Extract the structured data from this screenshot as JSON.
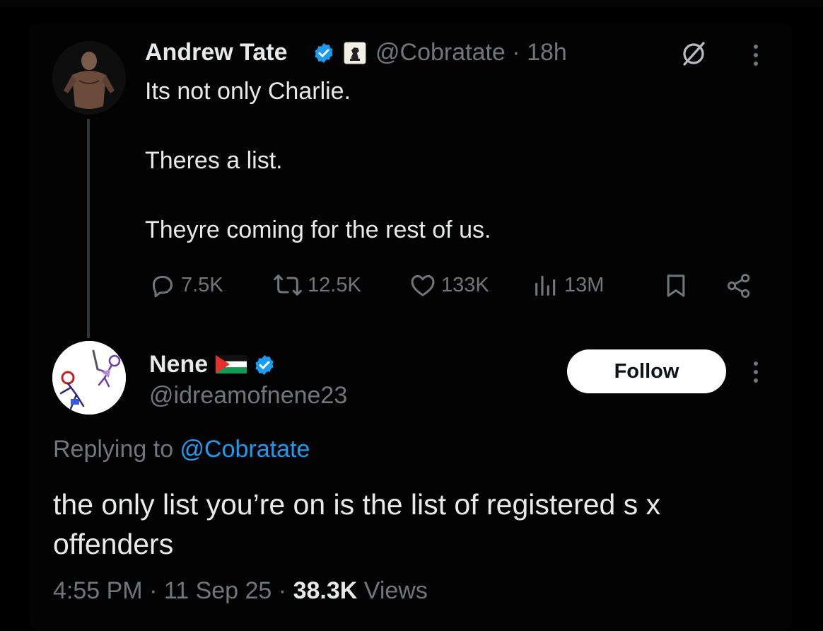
{
  "original_tweet": {
    "author_name": "Andrew Tate",
    "handle": "@Cobratate",
    "time_sep": " · ",
    "time": "18h",
    "lines": [
      "Its not only Charlie.",
      "Theres a list.",
      "Theyre coming for the rest of us."
    ],
    "stats": {
      "replies": "7.5K",
      "reposts": "12.5K",
      "likes": "133K",
      "views": "13M"
    }
  },
  "reply_tweet": {
    "author_name": "Nene",
    "handle": "@idreamofnene23",
    "follow_label": "Follow",
    "replying_prefix": "Replying to ",
    "replying_handle": "@Cobratate",
    "text": "the only list you’re on is the list of registered s x offenders",
    "time": "4:55 PM",
    "date": "11 Sep 25",
    "views_count": "38.3K",
    "views_label": "Views",
    "sep": " · "
  },
  "colors": {
    "background": "#000000",
    "text_primary": "#e7e9ea",
    "text_muted": "#71767b",
    "accent_blue": "#1d9bf0",
    "follow_bg": "#ffffff"
  },
  "icons": [
    "verified-badge-icon",
    "affiliate-badge-icon",
    "grok-icon",
    "more-icon",
    "reply-icon",
    "repost-icon",
    "like-icon",
    "views-icon",
    "bookmark-icon",
    "share-icon",
    "palestine-flag-icon"
  ]
}
